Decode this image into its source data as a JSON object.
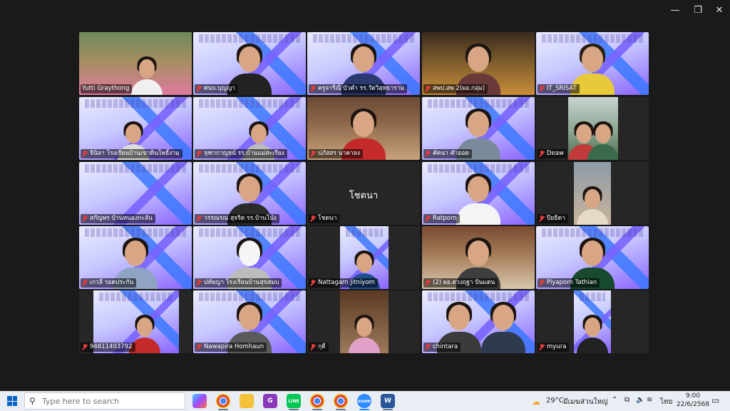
{
  "window": {
    "minimize": "—",
    "maximize": "❐",
    "close": "✕"
  },
  "participants": [
    {
      "name": "Yutti Graythong",
      "mic": false
    },
    {
      "name": "ศนบ.บุญญา",
      "mic": true
    },
    {
      "name": "ครูจารีณี บัวคำ รร.วัดวิสุทธาราม",
      "mic": true
    },
    {
      "name": "สพป.สพ 2(ผอ.กลุ่ม)",
      "mic": true
    },
    {
      "name": "IT_SRISAT",
      "mic": true
    },
    {
      "name": "จินิลา โรงเรียนบ้านเขาดินโพธิ์งาม",
      "mic": true
    },
    {
      "name": "จุฑากาญจน์ รร.บ้านแม่สะเรียง",
      "mic": true
    },
    {
      "name": "ปภัสสร นาคาลง",
      "mic": true
    },
    {
      "name": "คัคนา คำออด",
      "mic": true
    },
    {
      "name": "Deaw",
      "mic": true
    },
    {
      "name": "สกัญพร บ้านหนองกะลัน",
      "mic": true
    },
    {
      "name": "วรรณรณ สุจริต รร.บ้านโป่ง",
      "mic": true
    },
    {
      "name": "โชตนา",
      "mic": true,
      "center": "โชตนา"
    },
    {
      "name": "Ratporn",
      "mic": true
    },
    {
      "name": "ปิยธิดา",
      "mic": true
    },
    {
      "name": "เกวลี รอดประกัน",
      "mic": true
    },
    {
      "name": "ปทัยญา โรงเรียนบ้านสุขสมบ",
      "mic": true
    },
    {
      "name": "Nattagarn Jitniyom",
      "mic": true
    },
    {
      "name": "(2) ผอ.ดวงฤฐา ปันแดน",
      "mic": true
    },
    {
      "name": "Piyaporn Tathian",
      "mic": true
    },
    {
      "name": "94611403792",
      "mic": true
    },
    {
      "name": "Nawapira Homhaun",
      "mic": true
    },
    {
      "name": "กุดี",
      "mic": true
    },
    {
      "name": "chintara",
      "mic": true
    },
    {
      "name": "myura",
      "mic": true
    }
  ],
  "taskbar": {
    "search_placeholder": "Type here to search",
    "apps": [
      "copilot",
      "chrome",
      "files",
      "G",
      "LINE",
      "chrome",
      "chrome",
      "zoom",
      "W"
    ],
    "zoom_label": "zoom",
    "line_label": "LINE",
    "word_label": "W",
    "g_label": "G",
    "weather_temp": "29°C",
    "weather_desc": "มีเมฆส่วนใหญ่",
    "lang": "ไทย",
    "time": "9:00",
    "date": "22/6/2568"
  },
  "colors": {
    "active_speaker": "#23d96f",
    "muted_mic": "#e23b3b",
    "zoom": "#2d8cff"
  }
}
